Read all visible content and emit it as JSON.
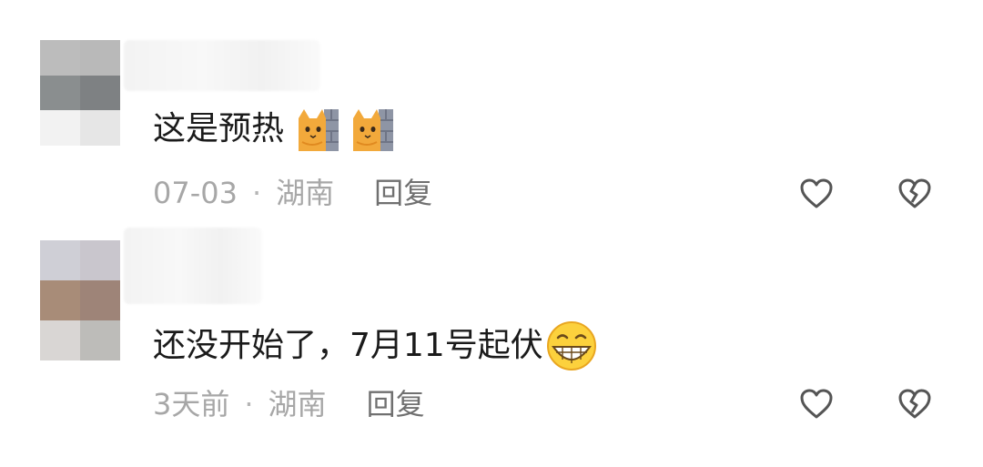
{
  "comments": [
    {
      "text": "这是预热",
      "emojis": [
        "cat-peeking-emoji",
        "cat-peeking-emoji"
      ],
      "time": "07-03",
      "separator": "·",
      "location": "湖南",
      "reply_label": "回复"
    },
    {
      "text": "还没开始了，7月11号起伏",
      "emojis": [
        "grinning-face-emoji"
      ],
      "time": "3天前",
      "separator": "·",
      "location": "湖南",
      "reply_label": "回复"
    }
  ],
  "icons": {
    "like": "heart-outline-icon",
    "dislike": "broken-heart-icon"
  },
  "colors": {
    "text": "#1b1b1b",
    "meta": "#a7a7a7",
    "reply": "#707070",
    "icon": "#555555"
  }
}
